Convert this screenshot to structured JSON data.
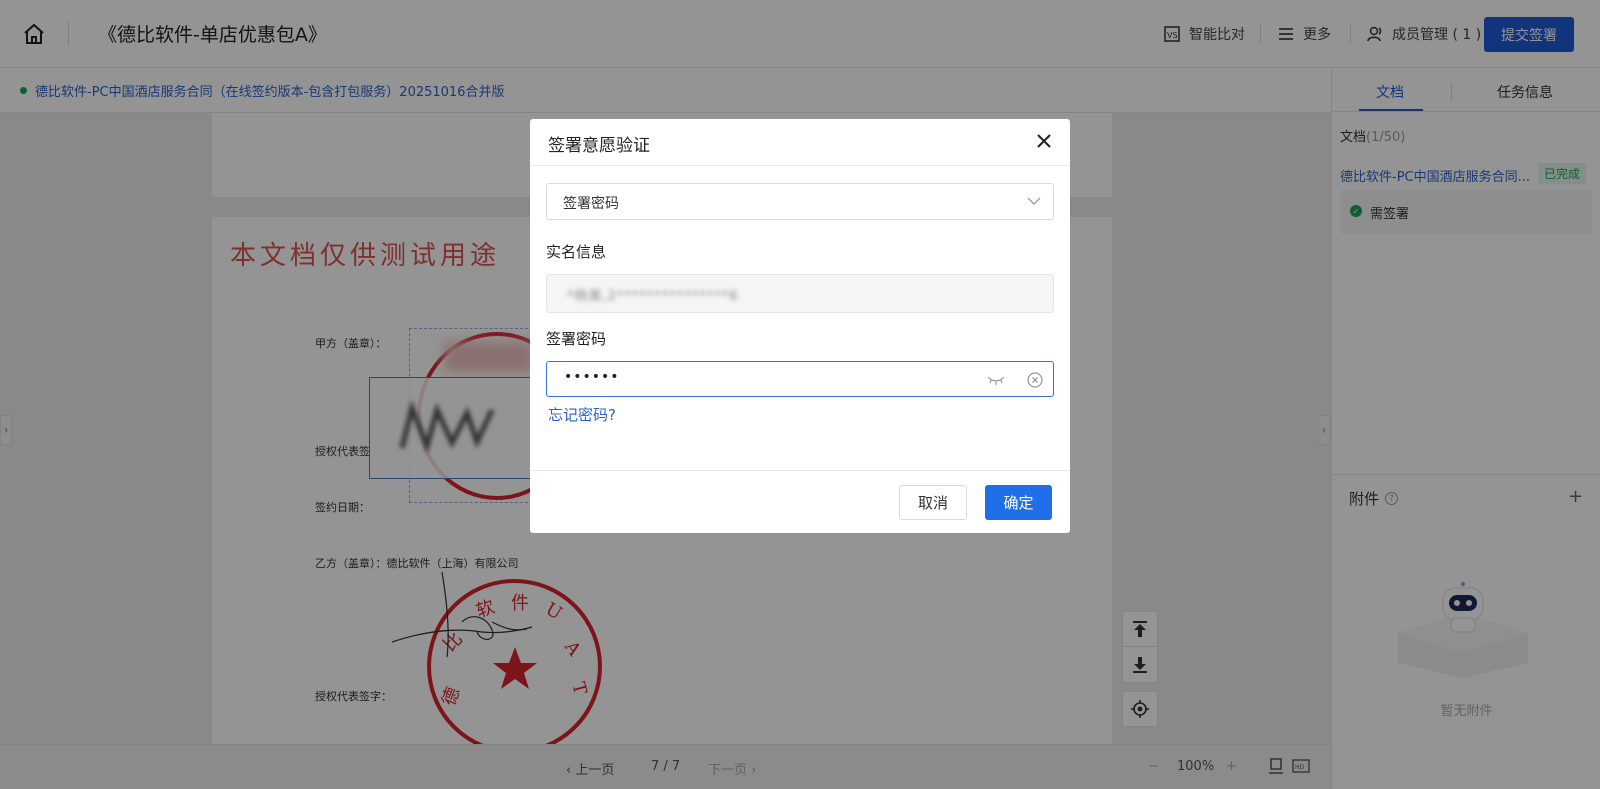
{
  "header": {
    "title": "《德比软件-单店优惠包A》",
    "compare_label": "智能比对",
    "more_label": "更多",
    "members_label": "成员管理 ( 1 )",
    "submit_label": "提交签署"
  },
  "subbar": {
    "doc_name": "德比软件-PC中国酒店服务合同（在线签约版本-包含打包服务）20251016合并版"
  },
  "document": {
    "watermark": "本文档仅供测试用途",
    "party_a_label": "甲方（盖章）：",
    "auth_rep_label_a": "授权代表签",
    "sign_date_label": "签约日期：",
    "party_b_label": "乙方（盖章）：德比软件（上海）有限公司",
    "auth_rep_label_b": "授权代表签字：",
    "seal_b_chars": [
      "德",
      "比",
      "软",
      "件",
      "U",
      "A",
      "T"
    ]
  },
  "bottombar": {
    "prev_label": "上一页",
    "page_indicator": "7 / 7",
    "next_label": "下一页",
    "zoom": "100%"
  },
  "right_panel": {
    "tabs": [
      {
        "label": "文档",
        "active": true
      },
      {
        "label": "任务信息",
        "active": false
      }
    ],
    "doc_count_label": "文档",
    "doc_count_value": "(1/50)",
    "doc_item_name": "德比软件-PC中国酒店服务合同...",
    "doc_item_status": "已完成",
    "need_sign_label": "需签署",
    "attachments_title": "附件",
    "no_attachments": "暂无附件"
  },
  "modal": {
    "title": "签署意愿验证",
    "method_selected": "签署密码",
    "realname_label": "实名信息",
    "realname_value": "*杨昊,2***************6",
    "password_label": "签署密码",
    "password_value": "••••••",
    "forgot_label": "忘记密码?",
    "cancel_label": "取消",
    "ok_label": "确定"
  },
  "colors": {
    "primary": "#1f5bd8",
    "confirm": "#1f6fe8",
    "link": "#2a62c9",
    "success": "#1aa35b",
    "seal_red": "#d8242c"
  }
}
